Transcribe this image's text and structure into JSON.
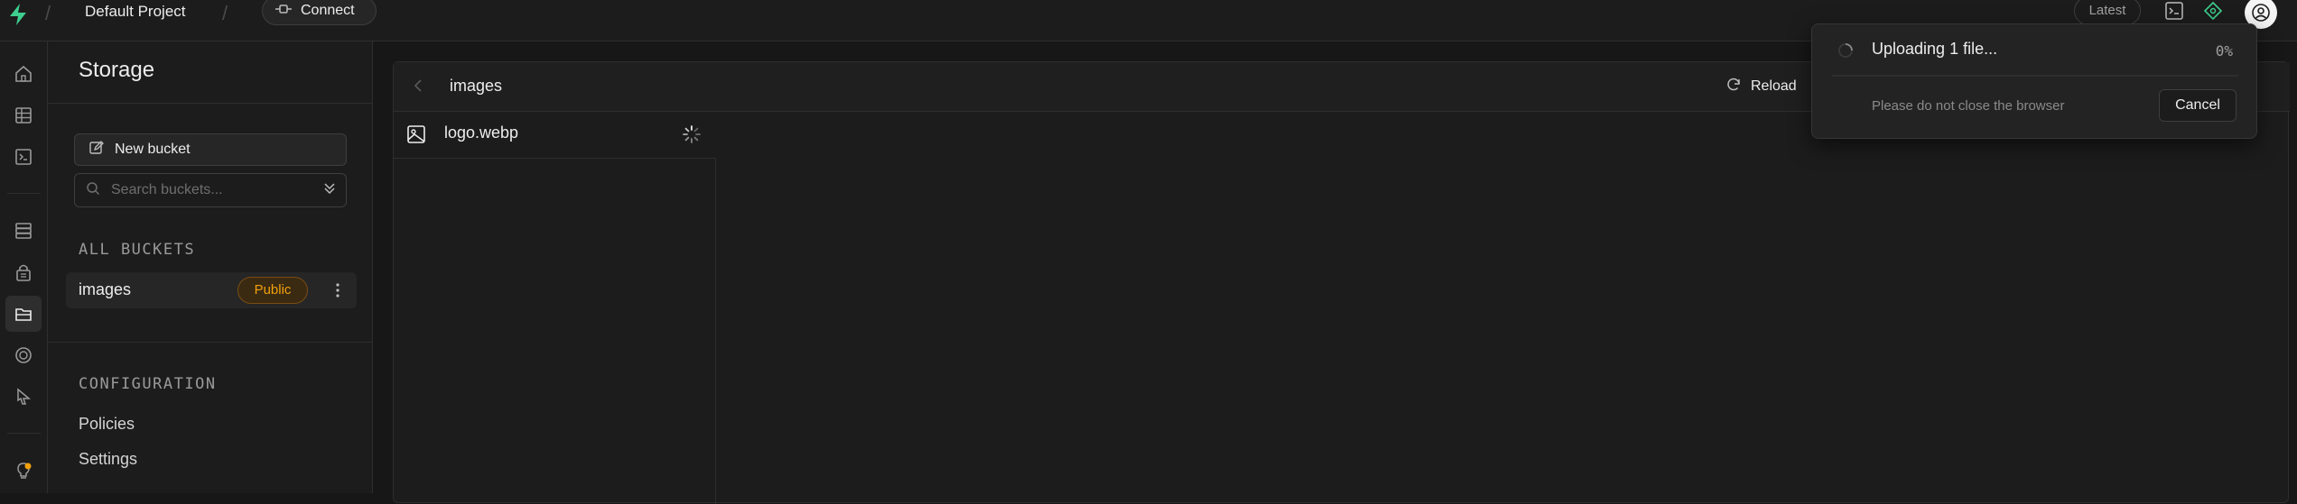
{
  "header": {
    "project_name": "Default Project",
    "connect_label": "Connect",
    "latest_label": "Latest"
  },
  "icons": {
    "logo": "supabase-logo-icon",
    "connect": "plug-icon",
    "terminal": "terminal-icon",
    "advisor": "diamond-icon",
    "user": "user-circle-icon"
  },
  "rail": {
    "items": [
      "home-icon",
      "table-editor-icon",
      "sql-editor-icon",
      "database-icon",
      "authentication-icon",
      "storage-icon",
      "realtime-icon",
      "edge-functions-icon",
      "advisors-icon"
    ],
    "active": "storage-icon"
  },
  "sidebar": {
    "title": "Storage",
    "new_bucket_label": "New bucket",
    "search_placeholder": "Search buckets...",
    "all_buckets_label": "ALL BUCKETS",
    "buckets": [
      {
        "name": "images",
        "badge": "Public"
      }
    ],
    "configuration_label": "CONFIGURATION",
    "config_items": [
      "Policies",
      "Settings"
    ]
  },
  "explorer": {
    "path": "images",
    "reload_label": "Reload",
    "files": [
      {
        "name": "logo.webp",
        "status": "uploading"
      }
    ]
  },
  "toast": {
    "title": "Uploading 1 file...",
    "percent": "0%",
    "progress": 0,
    "note": "Please do not close the browser",
    "cancel_label": "Cancel"
  },
  "colors": {
    "brand": "#3ecf8e",
    "badge_public": "#f1a10d",
    "background": "#171717",
    "panel": "#1c1c1c"
  }
}
